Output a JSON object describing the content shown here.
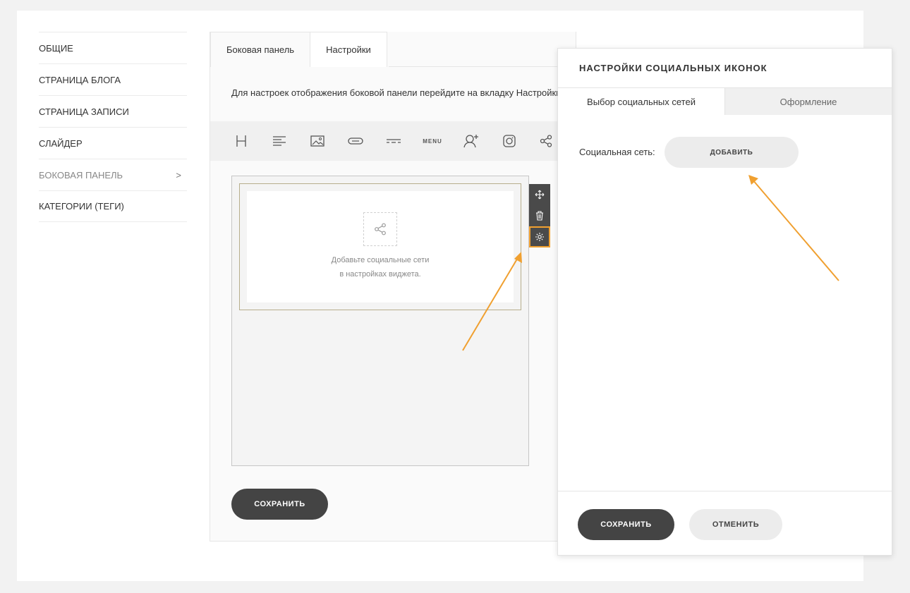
{
  "nav": {
    "items": [
      {
        "label": "ОБЩИЕ"
      },
      {
        "label": "СТРАНИЦА БЛОГА"
      },
      {
        "label": "СТРАНИЦА ЗАПИСИ"
      },
      {
        "label": "СЛАЙДЕР"
      },
      {
        "label": "БОКОВАЯ ПАНЕЛЬ",
        "chevron": ">"
      },
      {
        "label": "КАТЕГОРИИ (ТЕГИ)"
      }
    ]
  },
  "editor": {
    "tabs": [
      {
        "label": "Боковая панель"
      },
      {
        "label": "Настройки"
      }
    ],
    "hint": "Для настроек отображения боковой панели перейдите на вкладку Настройки",
    "toolbar": {
      "icons": [
        "heading-icon",
        "text-icon",
        "image-icon",
        "button-icon",
        "divider-icon",
        "menu-icon",
        "subscribe-icon",
        "instagram-icon",
        "share-icon"
      ],
      "menu_label": "MENU"
    },
    "widget": {
      "placeholder_line1": "Добавьте социальные сети",
      "placeholder_line2": "в настройках виджета."
    },
    "save_label": "СОХРАНИТЬ"
  },
  "modal": {
    "title": "НАСТРОЙКИ СОЦИАЛЬНЫХ ИКОНОК",
    "tabs": [
      {
        "label": "Выбор социальных сетей"
      },
      {
        "label": "Оформление"
      }
    ],
    "network_label": "Социальная сеть:",
    "add_label": "ДОБАВИТЬ",
    "save_label": "СОХРАНИТЬ",
    "cancel_label": "ОТМЕНИТЬ"
  },
  "colors": {
    "accent_arrow": "#f0a030",
    "dark_button": "#444444",
    "light_button": "#ececec"
  }
}
